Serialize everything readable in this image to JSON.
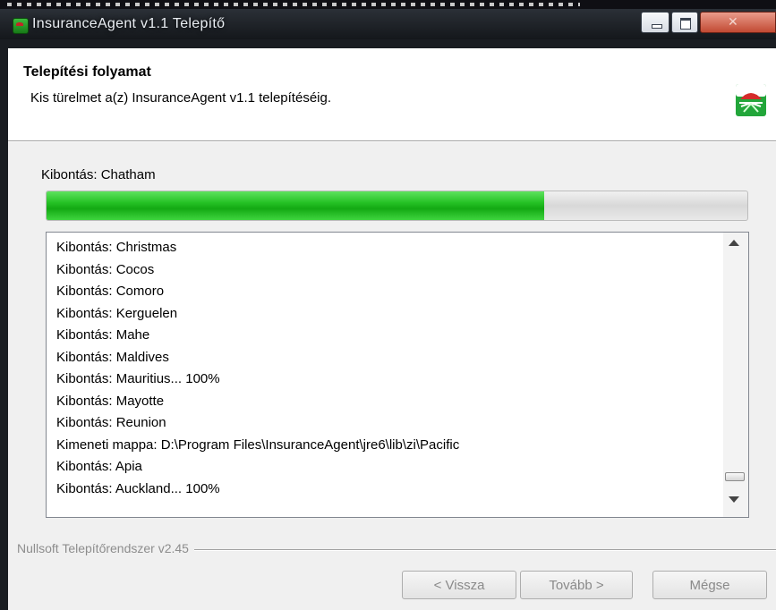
{
  "window": {
    "title": "InsuranceAgent v1.1 Telepítő"
  },
  "header": {
    "title": "Telepítési folyamat",
    "subtitle": "Kis türelmet a(z) InsuranceAgent v1.1 telepítéséig."
  },
  "progress": {
    "status": "Kibontás: Chatham",
    "fraction": 0.71
  },
  "log": {
    "lines": [
      "Kibontás: Christmas",
      "Kibontás: Cocos",
      "Kibontás: Comoro",
      "Kibontás: Kerguelen",
      "Kibontás: Mahe",
      "Kibontás: Maldives",
      "Kibontás: Mauritius... 100%",
      "Kibontás: Mayotte",
      "Kibontás: Reunion",
      "Kimeneti mappa: D:\\Program Files\\InsuranceAgent\\jre6\\lib\\zi\\Pacific",
      "Kibontás: Apia",
      "Kibontás: Auckland... 100%"
    ]
  },
  "footer": {
    "brand": "Nullsoft Telepítőrendszer v2.45",
    "back_label": "< Vissza",
    "next_label": "Tovább >",
    "cancel_label": "Mégse"
  },
  "icons": {
    "app": "installer-icon",
    "logo": "company-logo",
    "minimize": "minimize-icon",
    "maximize": "maximize-icon",
    "close": "close-icon",
    "scroll_up": "scroll-up-arrow-icon",
    "scroll_down": "scroll-down-arrow-icon"
  },
  "colors": {
    "progress_fill": "#21bf21",
    "disabled_text": "#8a8a8a"
  }
}
